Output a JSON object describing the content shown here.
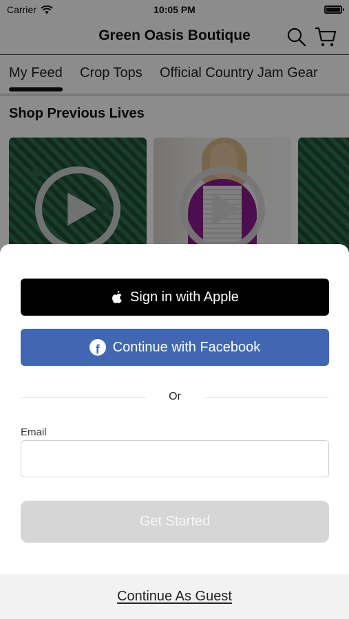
{
  "status_bar": {
    "carrier": "Carrier",
    "time": "10:05 PM"
  },
  "header": {
    "title": "Green Oasis Boutique"
  },
  "tabs": [
    {
      "label": "My Feed",
      "selected": true
    },
    {
      "label": "Crop Tops"
    },
    {
      "label": "Official Country Jam Gear"
    }
  ],
  "section": {
    "title": "Shop Previous Lives"
  },
  "sheet": {
    "apple_button": "Sign in with Apple",
    "facebook_button": "Continue with Facebook",
    "divider_text": "Or",
    "email_label": "Email",
    "email_value": "",
    "get_started_button": "Get Started",
    "guest_link": "Continue As Guest"
  },
  "colors": {
    "apple_button_bg": "#000000",
    "facebook_button_bg": "#4267b2",
    "get_started_bg": "#d6d6d6"
  },
  "icons": [
    "wifi-icon",
    "battery-icon",
    "search-icon",
    "cart-icon",
    "play-icon",
    "apple-icon",
    "facebook-icon"
  ]
}
